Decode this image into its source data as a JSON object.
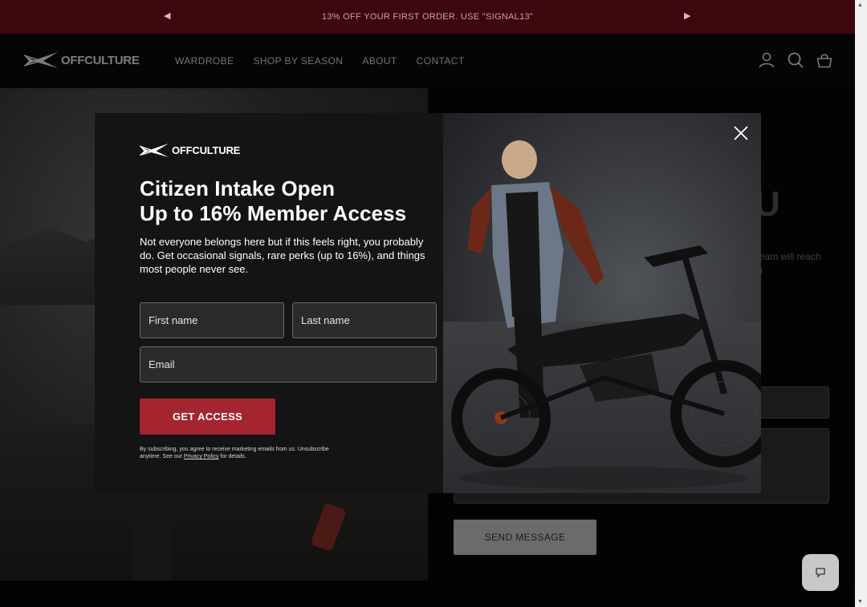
{
  "announcement": {
    "text": "13% OFF YOUR FIRST ORDER. USE \"SIGNAL13\"",
    "prev_glyph": "◀",
    "next_glyph": "▶"
  },
  "header": {
    "logo_text": "OFFCULTURE",
    "nav": [
      "WARDROBE",
      "SHOP BY SEASON",
      "ABOUT",
      "CONTACT"
    ],
    "icons": [
      "account-icon",
      "search-icon",
      "cart-icon"
    ]
  },
  "background": {
    "heading_fragment": "U",
    "contact_text_line1": "eam will reach",
    "contact_text_line2": ")",
    "send_label": "SEND MESSAGE"
  },
  "modal": {
    "logo_text": "OFFCULTURE",
    "title_line1": "Citizen Intake Open",
    "title_line2": "Up to 16% Member Access",
    "body": "Not everyone belongs here but if this feels right, you probably do. Get occasional signals, rare perks (up to 16%), and things most people never see.",
    "first_name_placeholder": "First name",
    "last_name_placeholder": "Last name",
    "email_placeholder": "Email",
    "cta_label": "GET ACCESS",
    "legal_prefix": "By subscribing, you agree to receive marketing emails from us. Unsubscribe anytime. See our ",
    "legal_link": "Privacy Policy",
    "legal_suffix": " for details."
  },
  "colors": {
    "accent": "#a4242f",
    "announcement_bg": "#7a0f1c",
    "modal_bg": "#141414"
  }
}
